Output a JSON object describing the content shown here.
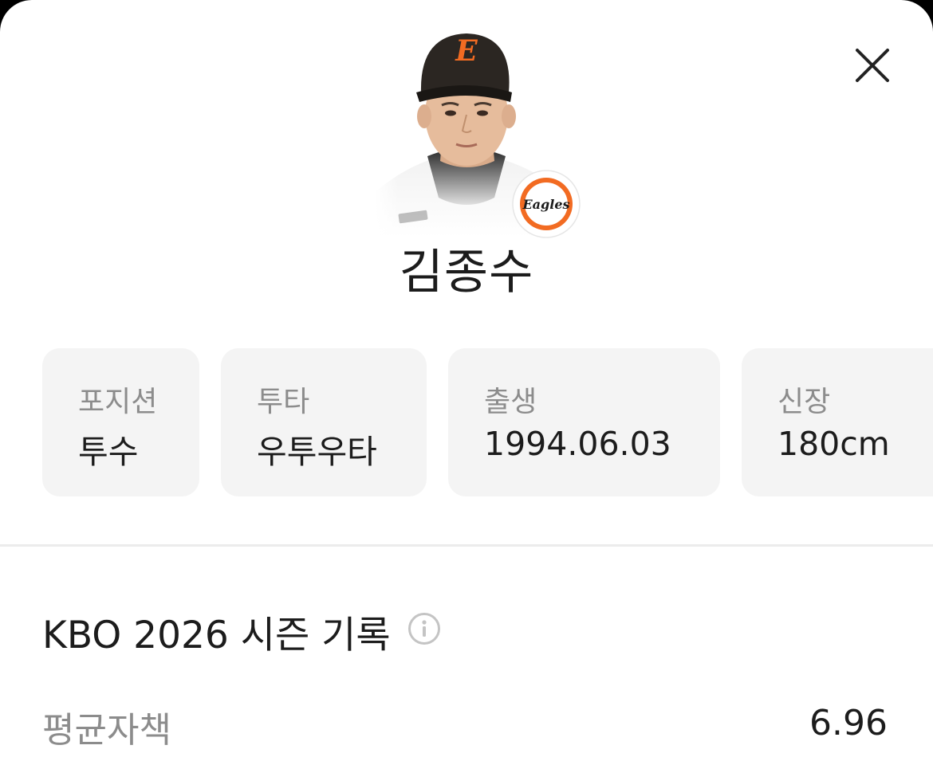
{
  "player": {
    "name": "김종수",
    "photo": "player-portrait",
    "team_logo": {
      "text": "Eagles",
      "icon": "eagles-logo",
      "accent": "#f26b22"
    },
    "cap_letter": "E"
  },
  "close": {
    "icon": "close-icon"
  },
  "info_cards": [
    {
      "label": "포지션",
      "value": "투수"
    },
    {
      "label": "투타",
      "value": "우투우타"
    },
    {
      "label": "출생",
      "value": "1994.06.03"
    },
    {
      "label": "신장",
      "value": "180cm"
    }
  ],
  "season": {
    "title": "KBO 2026 시즌 기록",
    "info_icon": "info-icon",
    "stats": [
      {
        "label": "평균자책",
        "value": "6.96"
      }
    ]
  },
  "colors": {
    "background": "#ffffff",
    "card": "#f4f4f4",
    "label": "#8c8c8c",
    "text": "#1c1c1c",
    "brand_orange": "#f26b22"
  }
}
